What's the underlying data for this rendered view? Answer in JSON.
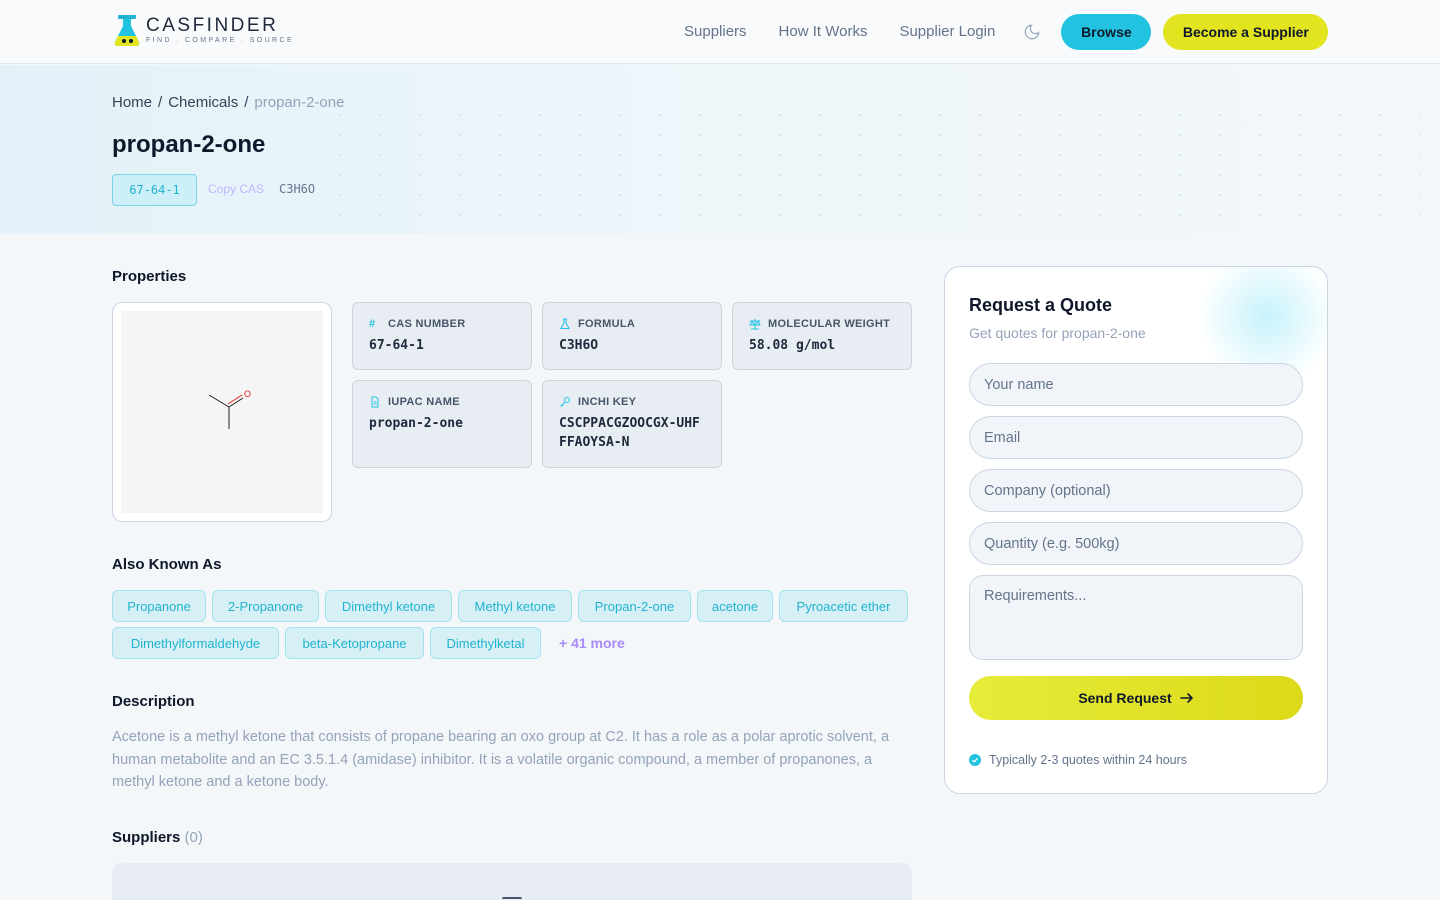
{
  "header": {
    "logo_name": "CASFINDER",
    "logo_tagline": "FIND . COMPARE . SOURCE",
    "nav": [
      "Suppliers",
      "How It Works",
      "Supplier Login"
    ],
    "browse_label": "Browse",
    "become_supplier_label": "Become a Supplier",
    "theme_icon": "moon-icon"
  },
  "breadcrumb": {
    "home": "Home",
    "chemicals": "Chemicals",
    "current": "propan-2-one",
    "separator": "/"
  },
  "hero": {
    "title": "propan-2-one",
    "cas": "67-64-1",
    "copy_label": "Copy CAS",
    "formula": "C3H6O"
  },
  "properties": {
    "heading": "Properties",
    "structure_atom_label": "O",
    "items": [
      {
        "label": "CAS NUMBER",
        "value": "67-64-1",
        "icon": "hash-icon"
      },
      {
        "label": "FORMULA",
        "value": "C3H6O",
        "icon": "flask-icon"
      },
      {
        "label": "MOLECULAR WEIGHT",
        "value": "58.08 g/mol",
        "icon": "scale-icon"
      },
      {
        "label": "IUPAC NAME",
        "value": "propan-2-one",
        "icon": "document-icon"
      },
      {
        "label": "INCHI KEY",
        "value": "CSCPPACGZOOCGX-UHFFFAOYSA-N",
        "icon": "key-icon"
      }
    ]
  },
  "synonyms": {
    "heading": "Also Known As",
    "items": [
      "Propanone",
      "2-Propanone",
      "Dimethyl ketone",
      "Methyl ketone",
      "Propan-2-one",
      "acetone",
      "Pyroacetic ether",
      "Dimethylformaldehyde",
      "beta-Ketopropane",
      "Dimethylketal"
    ],
    "more_label": "+ 41 more"
  },
  "description": {
    "heading": "Description",
    "text": "Acetone is a methyl ketone that consists of propane bearing an oxo group at C2. It has a role as a polar aprotic solvent, a human metabolite and an EC 3.5.1.4 (amidase) inhibitor. It is a volatile organic compound, a member of propanones, a methyl ketone and a ketone body."
  },
  "suppliers": {
    "heading": "Suppliers",
    "count": "(0)"
  },
  "quote": {
    "title": "Request a Quote",
    "subtitle": "Get quotes for propan-2-one",
    "name_placeholder": "Your name",
    "email_placeholder": "Email",
    "company_placeholder": "Company (optional)",
    "quantity_placeholder": "Quantity (e.g. 500kg)",
    "requirements_placeholder": "Requirements...",
    "send_label": "Send Request",
    "note": "Typically 2-3 quotes within 24 hours"
  },
  "colors": {
    "accent_cyan": "#22c3e0",
    "accent_yellow": "#e2e420",
    "accent_purple": "#a78bfa"
  }
}
